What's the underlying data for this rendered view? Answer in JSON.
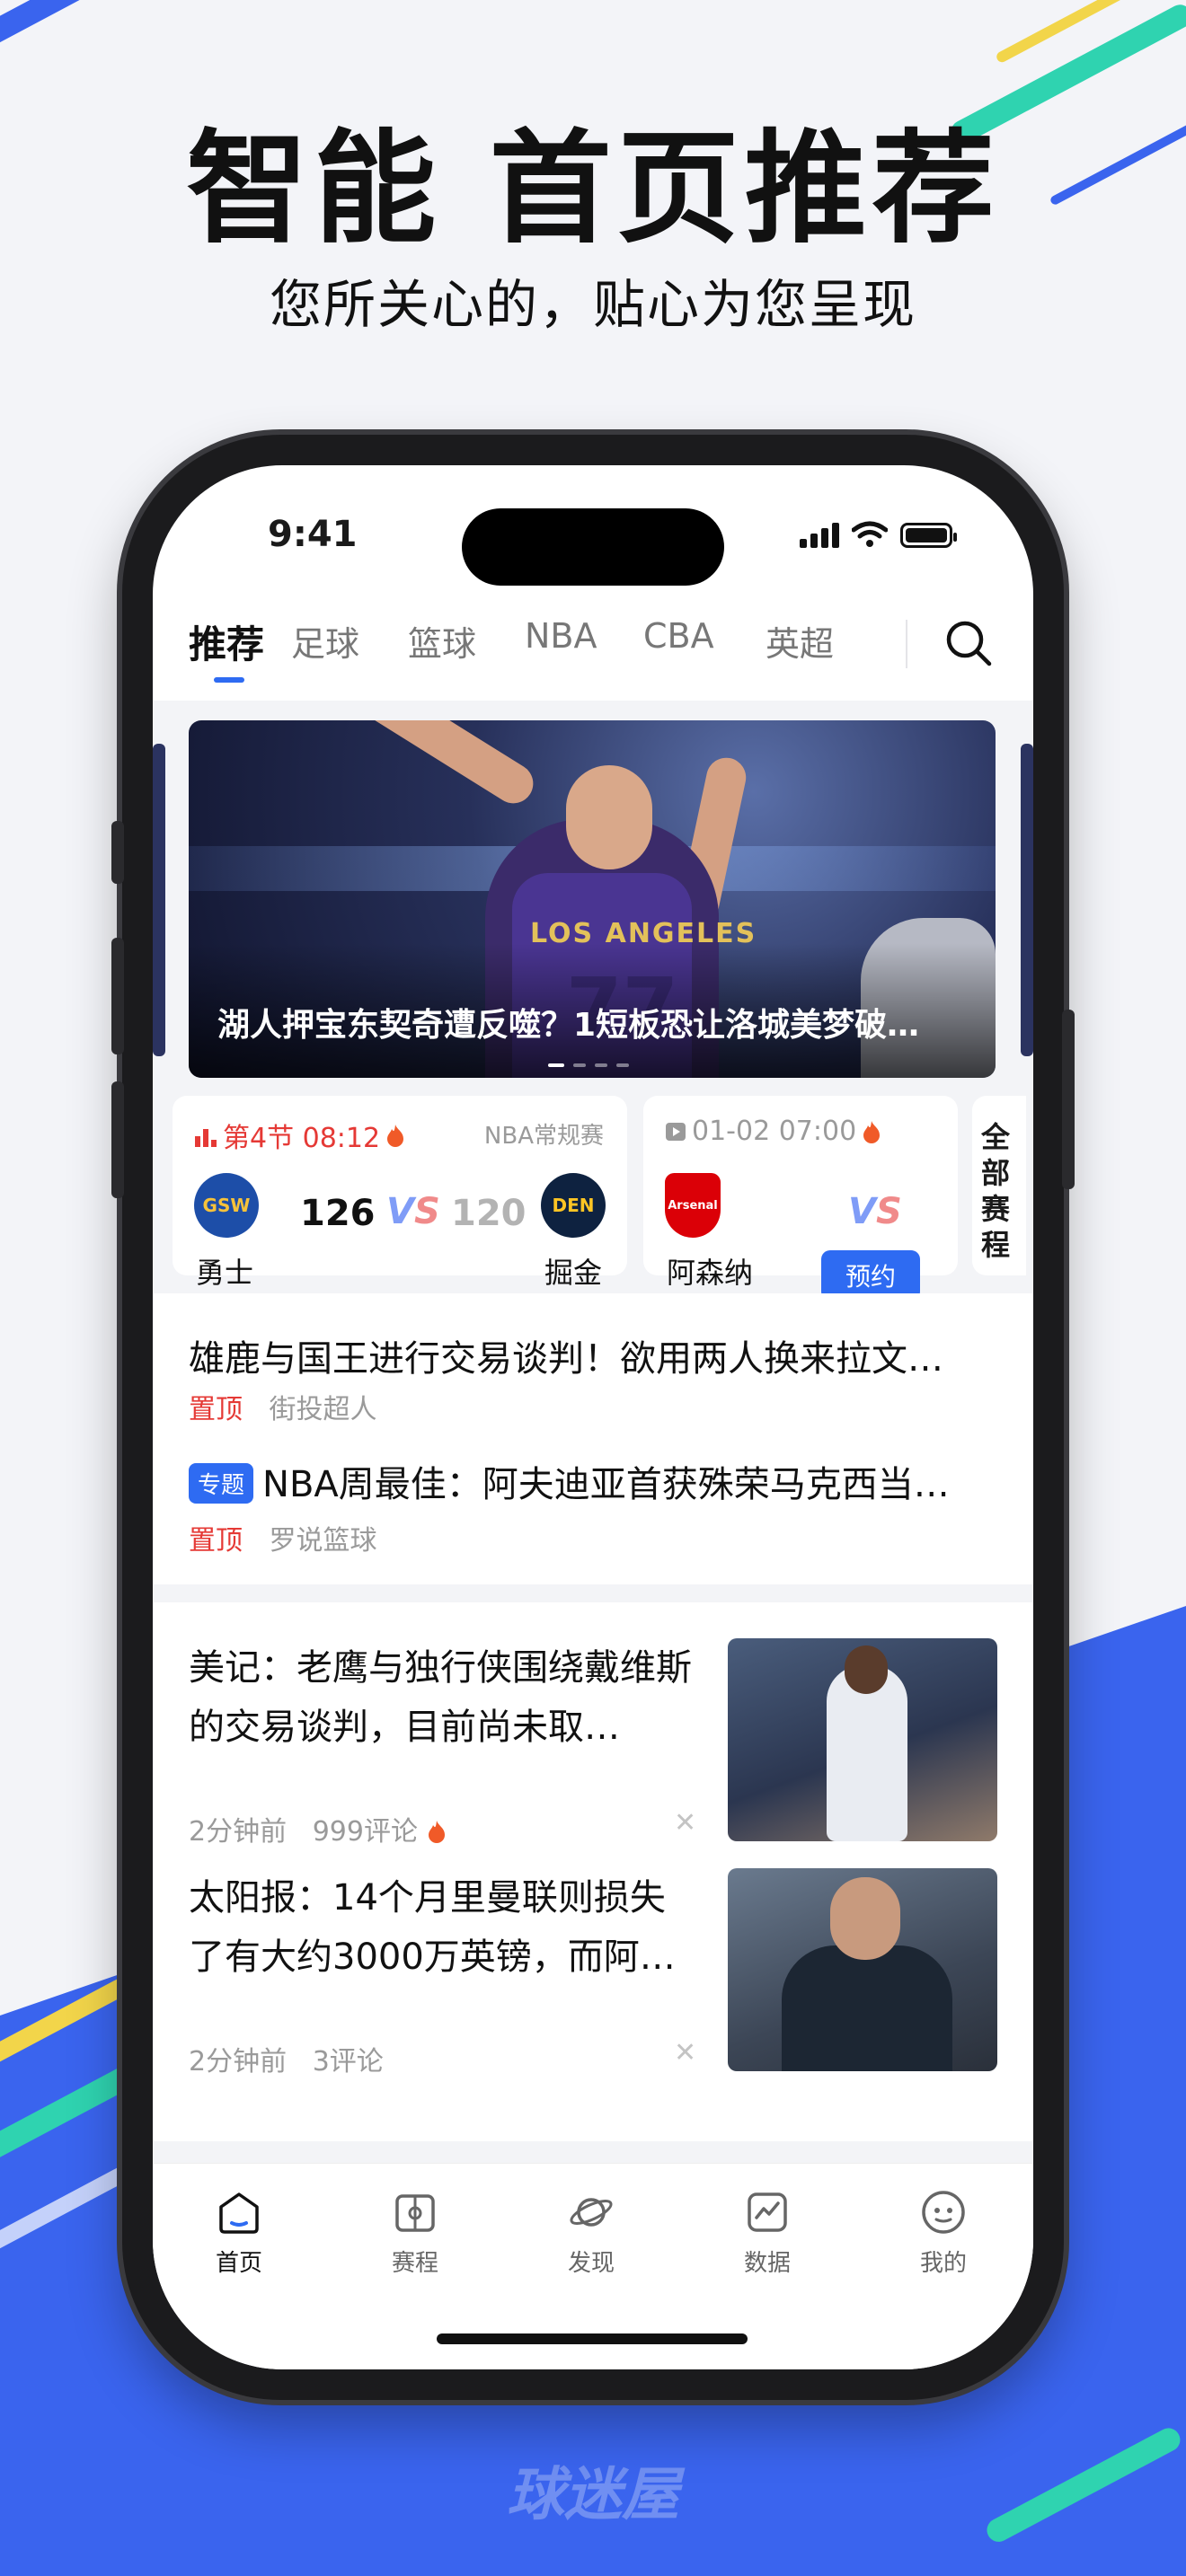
{
  "promo": {
    "headline": "智能 首页推荐",
    "subline": "您所关心的，贴心为您呈现",
    "brand": "球迷屋",
    "accent_blue": "#3a64ee",
    "stripe_teal": "#2fd3b0",
    "stripe_yellow": "#f2d54a"
  },
  "status_bar": {
    "time": "9:41"
  },
  "tabs": [
    {
      "label": "推荐",
      "active": true
    },
    {
      "label": "足球",
      "active": false
    },
    {
      "label": "篮球",
      "active": false
    },
    {
      "label": "NBA",
      "active": false
    },
    {
      "label": "CBA",
      "active": false
    },
    {
      "label": "英超",
      "active": false
    }
  ],
  "banner": {
    "title": "湖人押宝东契奇遭反噬？1短板恐让洛城美梦破…",
    "jersey_text": "LOS ANGELES",
    "jersey_number": "77"
  },
  "matches": [
    {
      "status": "第4节 08:12",
      "league": "NBA常规赛",
      "home_team": "勇士",
      "home_logo": "GSW",
      "home_score": "126",
      "away_team": "掘金",
      "away_logo": "DEN",
      "away_score": "120",
      "vs": "VS"
    },
    {
      "status": "01-02 07:00",
      "home_team": "阿森纳",
      "home_logo": "Arsenal",
      "vs": "VS",
      "action": "预约"
    }
  ],
  "all_schedule": "全部赛程",
  "pinned_news": [
    {
      "title": "雄鹿与国王进行交易谈判！欲用两人换来拉文…",
      "tag": "置顶",
      "source": "街投超人"
    },
    {
      "topic": "专题",
      "title": "NBA周最佳：阿夫迪亚首获殊荣马克西当…",
      "tag": "置顶",
      "source": "罗说篮球"
    }
  ],
  "news": [
    {
      "title": "美记：老鹰与独行侠围绕戴维斯的交易谈判，目前尚未取…",
      "time": "2分钟前",
      "comments": "999评论",
      "hot": true
    },
    {
      "title": "太阳报：14个月里曼联则损失了有大约3000万英镑，而阿…",
      "time": "2分钟前",
      "comments": "3评论",
      "hot": false
    }
  ],
  "bottom_nav": [
    {
      "label": "首页",
      "icon": "home-icon",
      "active": true
    },
    {
      "label": "赛程",
      "icon": "schedule-icon",
      "active": false
    },
    {
      "label": "发现",
      "icon": "planet-icon",
      "active": false
    },
    {
      "label": "数据",
      "icon": "chart-icon",
      "active": false
    },
    {
      "label": "我的",
      "icon": "profile-icon",
      "active": false
    }
  ]
}
